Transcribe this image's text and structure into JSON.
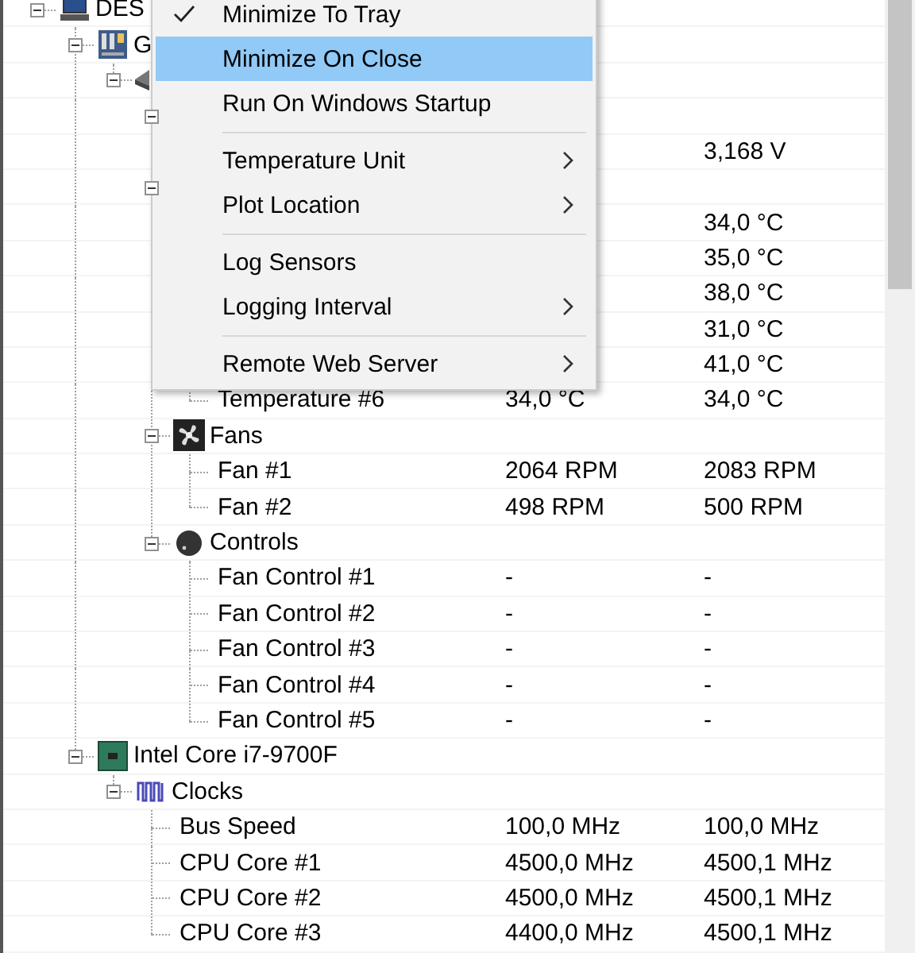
{
  "tree": [
    {
      "kind": "computer",
      "label": "DES",
      "expanded": true,
      "children": [
        {
          "kind": "mainboard",
          "label": "G",
          "expanded": true,
          "children": [
            {
              "kind": "chip",
              "expanded": true,
              "children": [
                {
                  "kind": "group",
                  "expanded": true,
                  "children": [
                    {
                      "kind": "sensor",
                      "max": "3,168 V"
                    }
                  ]
                },
                {
                  "kind": "group",
                  "expanded": true,
                  "children": [
                    {
                      "kind": "sensor",
                      "max": "34,0 °C"
                    },
                    {
                      "kind": "sensor",
                      "max": "35,0 °C"
                    },
                    {
                      "kind": "sensor",
                      "max": "38,0 °C"
                    },
                    {
                      "kind": "sensor",
                      "max": "31,0 °C"
                    },
                    {
                      "kind": "sensor",
                      "max": "41,0 °C"
                    },
                    {
                      "kind": "sensor",
                      "label": "Temperature #6",
                      "value": "34,0 °C",
                      "max": "34,0 °C"
                    }
                  ]
                },
                {
                  "kind": "fans",
                  "label": "Fans",
                  "expanded": true,
                  "children": [
                    {
                      "kind": "sensor",
                      "label": "Fan #1",
                      "value": "2064 RPM",
                      "max": "2083 RPM"
                    },
                    {
                      "kind": "sensor",
                      "label": "Fan #2",
                      "value": "498 RPM",
                      "max": "500 RPM"
                    }
                  ]
                },
                {
                  "kind": "controls",
                  "label": "Controls",
                  "expanded": true,
                  "children": [
                    {
                      "kind": "sensor",
                      "label": "Fan Control #1",
                      "value": "-",
                      "max": "-"
                    },
                    {
                      "kind": "sensor",
                      "label": "Fan Control #2",
                      "value": "-",
                      "max": "-"
                    },
                    {
                      "kind": "sensor",
                      "label": "Fan Control #3",
                      "value": "-",
                      "max": "-"
                    },
                    {
                      "kind": "sensor",
                      "label": "Fan Control #4",
                      "value": "-",
                      "max": "-"
                    },
                    {
                      "kind": "sensor",
                      "label": "Fan Control #5",
                      "value": "-",
                      "max": "-"
                    }
                  ]
                }
              ]
            }
          ]
        },
        {
          "kind": "cpu",
          "label": "Intel Core i7-9700F",
          "expanded": true,
          "children": [
            {
              "kind": "clocks",
              "label": "Clocks",
              "expanded": true,
              "children": [
                {
                  "kind": "sensor",
                  "label": "Bus Speed",
                  "value": "100,0 MHz",
                  "max": "100,0 MHz"
                },
                {
                  "kind": "sensor",
                  "label": "CPU Core #1",
                  "value": "4500,0 MHz",
                  "max": "4500,1 MHz"
                },
                {
                  "kind": "sensor",
                  "label": "CPU Core #2",
                  "value": "4500,0 MHz",
                  "max": "4500,1 MHz"
                },
                {
                  "kind": "sensor",
                  "label": "CPU Core #3",
                  "value": "4400,0 MHz",
                  "max": "4500,1 MHz"
                }
              ]
            }
          ]
        }
      ]
    }
  ],
  "menu": {
    "items": [
      {
        "kind": "item",
        "label": "Minimize To Tray",
        "checked": true,
        "selected": false
      },
      {
        "kind": "item",
        "label": "Minimize On Close",
        "selected": true
      },
      {
        "kind": "item",
        "label": "Run On Windows Startup",
        "selected": false
      },
      {
        "kind": "separator"
      },
      {
        "kind": "item",
        "label": "Temperature Unit",
        "selected": false,
        "submenu": true
      },
      {
        "kind": "item",
        "label": "Plot Location",
        "selected": false,
        "submenu": true
      },
      {
        "kind": "separator"
      },
      {
        "kind": "item",
        "label": "Log Sensors",
        "selected": false
      },
      {
        "kind": "item",
        "label": "Logging Interval",
        "selected": false,
        "submenu": true
      },
      {
        "kind": "separator"
      },
      {
        "kind": "item",
        "label": "Remote Web Server",
        "selected": false,
        "submenu": true
      }
    ]
  }
}
